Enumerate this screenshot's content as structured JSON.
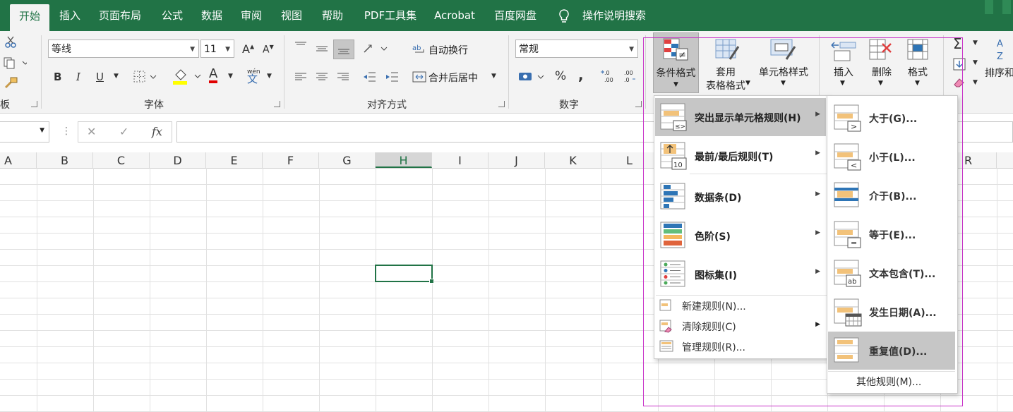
{
  "tabs": [
    "开始",
    "插入",
    "页面布局",
    "公式",
    "数据",
    "审阅",
    "视图",
    "帮助",
    "PDF工具集",
    "Acrobat",
    "百度网盘"
  ],
  "tell_me": "操作说明搜索",
  "ribbon": {
    "clipboard_label_partial": "板",
    "font": {
      "name": "等线",
      "size": "11",
      "bold": "B",
      "italic": "I",
      "underline": "U",
      "wen": "wén",
      "wen_char": "文",
      "grow": "A",
      "shrink": "A",
      "group_label": "字体",
      "font_color": "A"
    },
    "align": {
      "wrap": "自动换行",
      "merge": "合并后居中",
      "group_label": "对齐方式"
    },
    "number": {
      "format": "常规",
      "percent": "%",
      "comma": ",",
      "inc": ".0\n.00",
      "dec": ".00\n.0",
      "group_label": "数字"
    },
    "styles": {
      "cond_format": "条件格式",
      "table_format_1": "套用",
      "table_format_2": "表格格式",
      "cell_styles": "单元格样式"
    },
    "cells": {
      "insert": "插入",
      "delete": "删除",
      "format": "格式"
    },
    "editing": {
      "sort": "排序和"
    }
  },
  "formula_bar": {
    "cancel": "✕",
    "enter": "✓",
    "fx": "fx"
  },
  "columns": [
    "A",
    "B",
    "C",
    "D",
    "E",
    "F",
    "G",
    "H",
    "I",
    "J",
    "K",
    "L",
    "R"
  ],
  "cf_menu": {
    "items": [
      {
        "label": "突出显示单元格规则(H)",
        "key": "H"
      },
      {
        "label": "最前/最后规则(T)",
        "key": "T"
      },
      {
        "label": "数据条(D)",
        "key": "D"
      },
      {
        "label": "色阶(S)",
        "key": "S"
      },
      {
        "label": "图标集(I)",
        "key": "I"
      }
    ],
    "small_items": [
      {
        "label": "新建规则(N)..."
      },
      {
        "label": "清除规则(C)"
      },
      {
        "label": "管理规则(R)..."
      }
    ],
    "icon_text": {
      "neq": "≠",
      "ten": "10",
      "lt_gt": "≤>"
    }
  },
  "submenu": {
    "items": [
      {
        "label": "大于(G)...",
        "symbol": ">"
      },
      {
        "label": "小于(L)...",
        "symbol": "<"
      },
      {
        "label": "介于(B)...",
        "symbol": ""
      },
      {
        "label": "等于(E)...",
        "symbol": "="
      },
      {
        "label": "文本包含(T)...",
        "symbol": "ab"
      },
      {
        "label": "发生日期(A)...",
        "symbol": ""
      },
      {
        "label": "重复值(D)...",
        "symbol": ""
      }
    ],
    "more": "其他规则(M)..."
  },
  "colors": {
    "excel_green": "#217346",
    "highlight": "#c6c6c6",
    "outline": "#c832c8",
    "bar_blue": "#2e75b6",
    "cell_yellow": "#f2c27a",
    "font_red": "#e00000",
    "fill_yellow": "#ffff00"
  }
}
